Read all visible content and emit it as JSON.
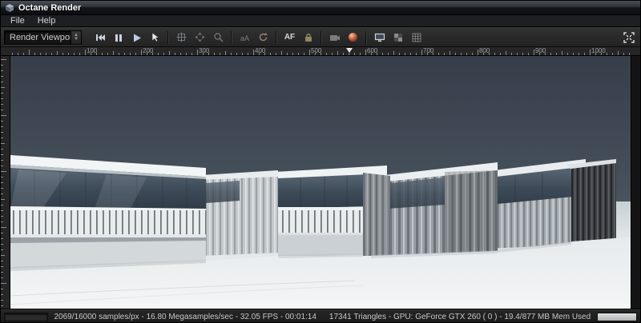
{
  "window": {
    "title": "Octane Render"
  },
  "menu": {
    "file": "File",
    "help": "Help"
  },
  "toolbar": {
    "viewport_select": {
      "value": "Render Viewport"
    },
    "af_button": "AF",
    "icons": [
      "skip-to-start",
      "pause",
      "play",
      "pick-cursor",
      "focus-pick",
      "pan-view",
      "zoom-view",
      "font-aa",
      "refresh-render",
      "af-toggle",
      "lock-resolution",
      "camera",
      "material-ball",
      "display-mode",
      "checker-background",
      "grid-overlay",
      "fullscreen"
    ]
  },
  "ruler": {
    "labels": [
      "100",
      "200",
      "300",
      "400",
      "500",
      "600",
      "700",
      "800",
      "900",
      "1000"
    ],
    "marker_label": "position-marker"
  },
  "scene": {
    "description": "3D render of snow-covered modular buildings with corrugated walls and white railings under a dark blue-grey sky"
  },
  "status": {
    "render_stats": "2069/16000 samples/px - 16.80 Megasamples/sec - 32.05 FPS - 00:01:14",
    "gpu_stats": "17341 Triangles - GPU: GeForce GTX 260 ( 0 ) - 19.4/877 MB Mem Used"
  },
  "colors": {
    "sky_top": "#38414c",
    "sky_bottom": "#4d5761",
    "snow": "#eef1f2",
    "glass": "#3e4b59",
    "ui_dark": "#232323"
  }
}
